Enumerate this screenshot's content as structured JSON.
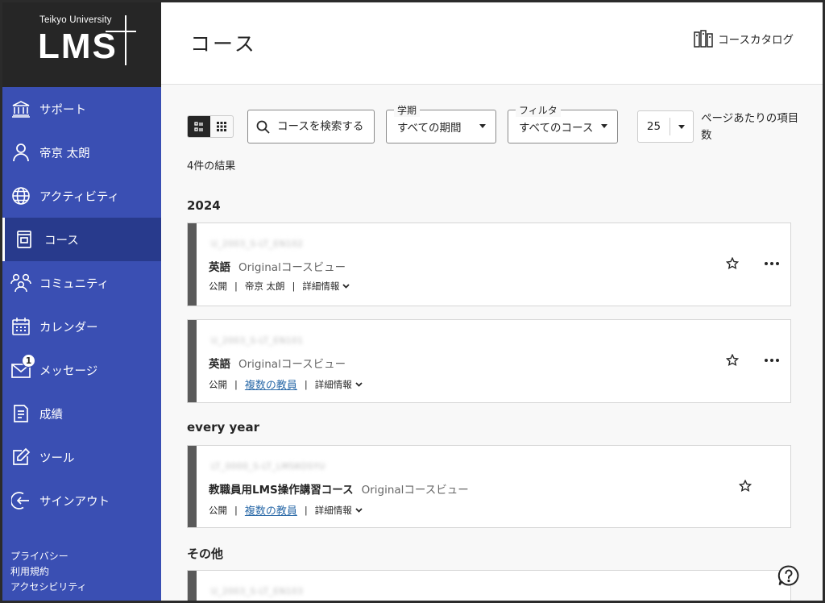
{
  "brand": {
    "university": "Teikyo University",
    "product": "LMS"
  },
  "sidebar": {
    "items": [
      {
        "label": "サポート",
        "icon": "bank-icon"
      },
      {
        "label": "帝京 太朗",
        "icon": "user-icon"
      },
      {
        "label": "アクティビティ",
        "icon": "globe-icon"
      },
      {
        "label": "コース",
        "icon": "book-icon",
        "active": true
      },
      {
        "label": "コミュニティ",
        "icon": "community-icon"
      },
      {
        "label": "カレンダー",
        "icon": "calendar-icon"
      },
      {
        "label": "メッセージ",
        "icon": "mail-icon",
        "badge": "1"
      },
      {
        "label": "成績",
        "icon": "grades-icon"
      },
      {
        "label": "ツール",
        "icon": "edit-icon"
      },
      {
        "label": "サインアウト",
        "icon": "signout-icon"
      }
    ],
    "footer": [
      "プライバシー",
      "利用規約",
      "アクセシビリティ"
    ]
  },
  "header": {
    "title": "コース",
    "catalog_label": "コースカタログ"
  },
  "toolbar": {
    "search_placeholder": "コースを検索する",
    "term_legend": "学期",
    "term_value": "すべての期間",
    "filter_legend": "フィルタ",
    "filter_value": "すべてのコース",
    "per_page_value": "25",
    "per_page_label": "ページあたりの項目数"
  },
  "results_label": "4件の結果",
  "groups": [
    {
      "title": "2024"
    },
    {
      "title": "every year"
    },
    {
      "title": "その他"
    }
  ],
  "courses": [
    {
      "id": "U_2003_S-LT_EN102",
      "name": "英語",
      "view": "Originalコースビュー",
      "status": "公開",
      "instructor": "帝京 太朗",
      "instructor_link": false,
      "details": "詳細情報",
      "has_menu": true
    },
    {
      "id": "U_2003_S-LT_EN101",
      "name": "英語",
      "view": "Originalコースビュー",
      "status": "公開",
      "instructor": "複数の教員",
      "instructor_link": true,
      "details": "詳細情報",
      "has_menu": true
    },
    {
      "id": "LT_0000_S-LT_LMSKOSYU",
      "name": "教職員用LMS操作講習コース",
      "view": "Originalコースビュー",
      "status": "公開",
      "instructor": "複数の教員",
      "instructor_link": true,
      "details": "詳細情報",
      "has_menu": false
    },
    {
      "id": "U_2003_S-LT_EN103"
    }
  ],
  "colors": {
    "sidebar": "#3a4fb3",
    "sidebar_active": "#283a8c",
    "logo_bg": "#262626",
    "link": "#2b6aa8"
  }
}
